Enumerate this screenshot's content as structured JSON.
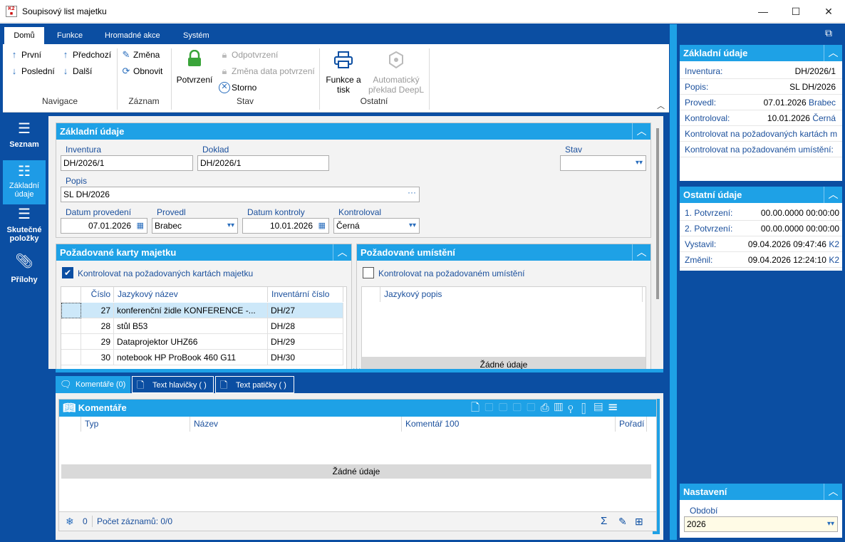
{
  "window": {
    "title": "Soupisový list majetku",
    "minimize": "—",
    "maximize": "☐",
    "close": "✕"
  },
  "ribbon": {
    "tabs": [
      "Domů",
      "Funkce",
      "Hromadné akce",
      "Systém"
    ],
    "navigace": {
      "first": "První",
      "prev": "Předchozí",
      "last": "Poslední",
      "next": "Další",
      "group": "Navigace"
    },
    "zaznam": {
      "edit": "Změna",
      "refresh": "Obnovit",
      "group": "Záznam"
    },
    "stav": {
      "confirm": "Potvrzení",
      "unconfirm": "Odpotvrzení",
      "change_date": "Změna data potvrzení",
      "cancel": "Storno",
      "group": "Stav"
    },
    "ostatni": {
      "print_l1": "Funkce a",
      "print_l2": "tisk",
      "deepl_l1": "Automatický",
      "deepl_l2": "překlad DeepL",
      "group": "Ostatní"
    }
  },
  "leftnav": [
    {
      "label_l1": "Seznam",
      "label_l2": ""
    },
    {
      "label_l1": "Základní",
      "label_l2": "údaje"
    },
    {
      "label_l1": "Skutečné",
      "label_l2": "položky"
    },
    {
      "label_l1": "Přílohy",
      "label_l2": ""
    }
  ],
  "basic": {
    "title": "Základní údaje",
    "inventura_label": "Inventura",
    "inventura": "DH/2026/1",
    "doklad_label": "Doklad",
    "doklad": "DH/2026/1",
    "stav_label": "Stav",
    "stav": "",
    "popis_label": "Popis",
    "popis": "SL DH/2026",
    "datum_provedeni_label": "Datum provedení",
    "datum_provedeni": "07.01.2026",
    "provedl_label": "Provedl",
    "provedl": "Brabec",
    "datum_kontroly_label": "Datum kontroly",
    "datum_kontroly": "10.01.2026",
    "kontroloval_label": "Kontroloval",
    "kontroloval": "Černá"
  },
  "cards": {
    "title": "Požadované karty majetku",
    "check_label": "Kontrolovat na požadovaných kartách majetku",
    "columns": [
      "Číslo",
      "Jazykový název",
      "Inventární číslo"
    ],
    "rows": [
      {
        "cislo": "27",
        "nazev": "konferenční židle KONFERENCE -...",
        "inv": "DH/27"
      },
      {
        "cislo": "28",
        "nazev": "stůl B53",
        "inv": "DH/28"
      },
      {
        "cislo": "29",
        "nazev": "Dataprojektor UHZ66",
        "inv": "DH/29"
      },
      {
        "cislo": "30",
        "nazev": "notebook HP ProBook 460 G11",
        "inv": "DH/30"
      }
    ]
  },
  "locations": {
    "title": "Požadované umístění",
    "check_label": "Kontrolovat na požadovaném umístění",
    "column": "Jazykový popis",
    "empty": "Žádné údaje"
  },
  "bottom_tabs": [
    "Komentáře (0)",
    "Text hlavičky ( )",
    "Text patičky ( )"
  ],
  "comments": {
    "title": "Komentáře",
    "columns": [
      "Typ",
      "Název",
      "Komentář 100",
      "Pořadí"
    ],
    "empty": "Žádné údaje",
    "count": "0",
    "records": "Počet záznamů: 0/0"
  },
  "right": {
    "basic_title": "Základní údaje",
    "basic_rows": [
      {
        "k": "Inventura:",
        "v": "DH/2026/1",
        "s": ""
      },
      {
        "k": "Popis:",
        "v": "SL DH/2026",
        "s": ""
      },
      {
        "k": "Provedl:",
        "v": "07.01.2026",
        "s": "Brabec"
      },
      {
        "k": "Kontroloval:",
        "v": "10.01.2026",
        "s": "Černá"
      },
      {
        "k": "Kontrolovat na požadovaných kartách m",
        "v": "",
        "s": ""
      },
      {
        "k": "Kontrolovat na požadovaném umístění:",
        "v": "",
        "s": ""
      }
    ],
    "other_title": "Ostatní údaje",
    "other_rows": [
      {
        "k": "1. Potvrzení:",
        "v": "00.00.0000 00:00:00",
        "s": ""
      },
      {
        "k": "2. Potvrzení:",
        "v": "00.00.0000 00:00:00",
        "s": ""
      },
      {
        "k": "Vystavil:",
        "v": "09.04.2026 09:47:46",
        "s": "K2"
      },
      {
        "k": "Změnil:",
        "v": "09.04.2026 12:24:10",
        "s": "K2"
      }
    ],
    "settings_title": "Nastavení",
    "obdobi_label": "Období",
    "obdobi": "2026"
  },
  "colors": {
    "frame": "#0b4ea2",
    "accent": "#1ea1e6"
  }
}
